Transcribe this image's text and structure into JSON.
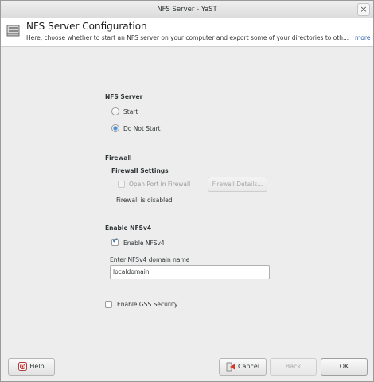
{
  "window": {
    "title": "NFS Server - YaST",
    "close_symbol": "×"
  },
  "header": {
    "title": "NFS Server Configuration",
    "description": "Here, choose whether to start an NFS server on your computer and export some of your directories to oth...",
    "more_link": "more"
  },
  "nfs_server": {
    "section_title": "NFS Server",
    "options": [
      {
        "label": "Start",
        "checked": false
      },
      {
        "label": "Do Not Start",
        "checked": true
      }
    ]
  },
  "firewall": {
    "section_title": "Firewall",
    "settings_title": "Firewall Settings",
    "open_port_label": "Open Port in Firewall",
    "details_button": "Firewall Details...",
    "status_text": "Firewall is disabled"
  },
  "nfsv4": {
    "section_title": "Enable NFSv4",
    "enable_label": "Enable NFSv4",
    "enabled": true,
    "domain_label": "Enter NFSv4 domain name",
    "domain_value": "localdomain"
  },
  "gss": {
    "label": "Enable GSS Security",
    "checked": false
  },
  "footer": {
    "help_label": "Help",
    "cancel_label": "Cancel",
    "back_label": "Back",
    "ok_label": "OK"
  },
  "icons": {
    "header": "nfs-server-icon",
    "help": "help-icon",
    "cancel": "cancel-icon"
  }
}
